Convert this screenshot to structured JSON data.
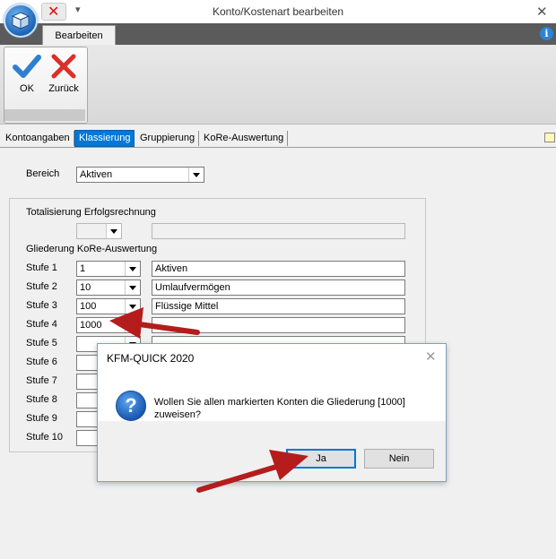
{
  "window": {
    "title": "Konto/Kostenart bearbeiten",
    "close_glyph": "✕",
    "quick_access_close_glyph": "✕",
    "quick_access_dropdown_glyph": "▾"
  },
  "ribbon": {
    "tab": "Bearbeiten",
    "info_glyph": "i",
    "buttons": [
      {
        "label": "OK",
        "icon": "checkmark-icon",
        "color": "#2f7fd0"
      },
      {
        "label": "Zurück",
        "icon": "x-icon",
        "color": "#d9302a"
      }
    ]
  },
  "tabs": [
    {
      "label": "Kontoangaben",
      "active": false
    },
    {
      "label": "Klassierung",
      "active": true
    },
    {
      "label": "Gruppierung",
      "active": false
    },
    {
      "label": "KoRe-Auswertung",
      "active": false
    }
  ],
  "form": {
    "bereich": {
      "label": "Bereich",
      "value": "Aktiven"
    },
    "totalisierung": {
      "label": "Totalisierung Erfolgsrechnung",
      "value": "",
      "text": ""
    },
    "gliederung_label": "Gliederung KoRe-Auswertung",
    "stufen": [
      {
        "label": "Stufe 1",
        "code": "1",
        "text": "Aktiven"
      },
      {
        "label": "Stufe 2",
        "code": "10",
        "text": "Umlaufvermögen"
      },
      {
        "label": "Stufe 3",
        "code": "100",
        "text": "Flüssige Mittel"
      },
      {
        "label": "Stufe 4",
        "code": "1000",
        "text": ""
      },
      {
        "label": "Stufe 5",
        "code": "",
        "text": ""
      },
      {
        "label": "Stufe 6",
        "code": "",
        "text": ""
      },
      {
        "label": "Stufe 7",
        "code": "",
        "text": ""
      },
      {
        "label": "Stufe 8",
        "code": "",
        "text": ""
      },
      {
        "label": "Stufe 9",
        "code": "",
        "text": ""
      },
      {
        "label": "Stufe 10",
        "code": "",
        "text": ""
      }
    ]
  },
  "dialog": {
    "title": "KFM-QUICK  2020",
    "close_glyph": "✕",
    "icon": "question-icon",
    "icon_glyph": "?",
    "message": "Wollen Sie allen markierten Konten die Gliederung [1000] zuweisen?",
    "yes_label": "Ja",
    "no_label": "Nein"
  },
  "annotations": {
    "arrow_color": "#b51c1c"
  }
}
